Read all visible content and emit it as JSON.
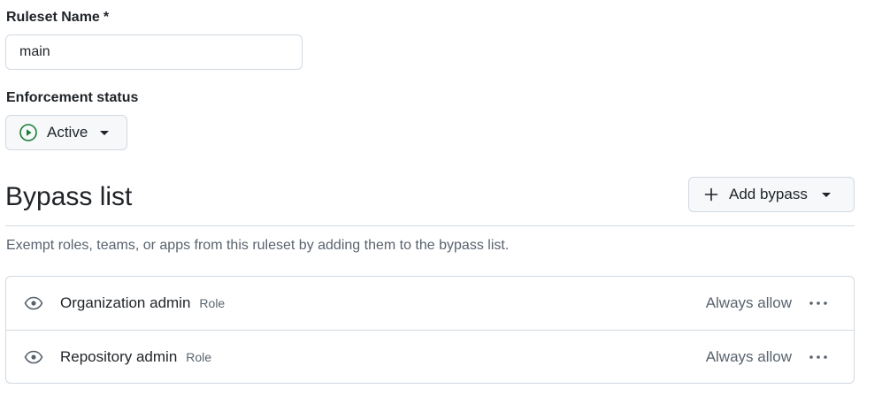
{
  "form": {
    "name_label": "Ruleset Name",
    "required_mark": "*",
    "name_value": "main",
    "status_label": "Enforcement status",
    "status_value": "Active"
  },
  "bypass": {
    "title": "Bypass list",
    "add_button_label": "Add bypass",
    "description": "Exempt roles, teams, or apps from this ruleset by adding them to the bypass list.",
    "items": [
      {
        "name": "Organization admin",
        "type": "Role",
        "mode": "Always allow",
        "icon": "eye-icon"
      },
      {
        "name": "Repository admin",
        "type": "Role",
        "mode": "Always allow",
        "icon": "eye-icon"
      }
    ]
  },
  "colors": {
    "active_green": "#1a7f37",
    "border": "#d1d9e0",
    "muted_text": "#59636e",
    "button_bg": "#f6f8fa"
  }
}
